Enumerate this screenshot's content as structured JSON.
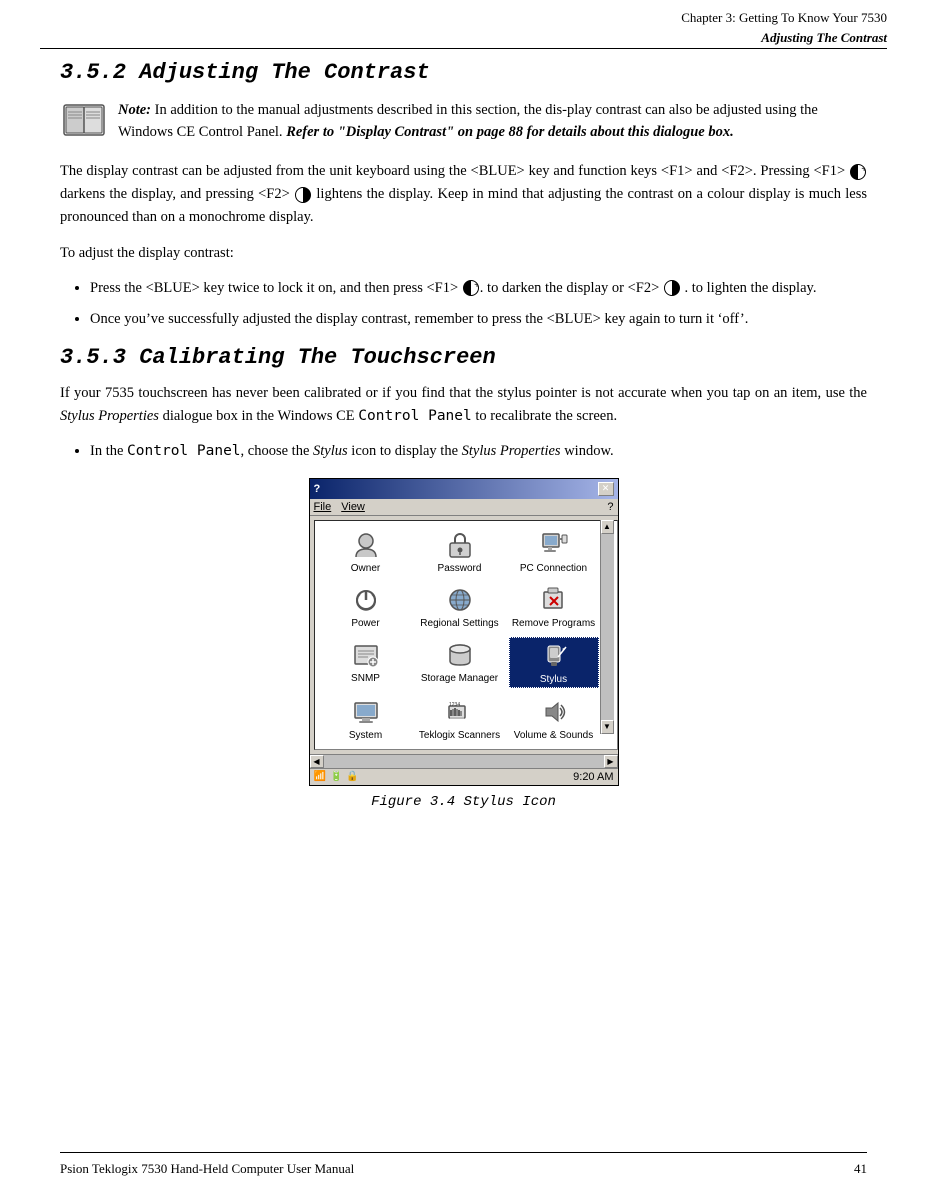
{
  "header": {
    "chapter_line": "Chapter  3:  Getting To Know Your 7530",
    "section_title": "Adjusting The Contrast"
  },
  "section_352": {
    "heading": "3.5.2   Adjusting The Contrast",
    "note_label": "Note:",
    "note_text": "In addition to the manual adjustments described in this section, the dis-play contrast can also be adjusted using the Windows CE Control Panel. ",
    "note_bold": "Refer to “Display Contrast” on page 88 for details about this dialogue box.",
    "para1": "The display contrast can be adjusted from the unit keyboard using the <BLUE> key and function keys <F1> and <F2>. Pressing <F1>",
    "para1b": "darkens the display, and pressing <F2>",
    "para1c": "lightens the display. Keep in mind that adjusting the contrast on a colour display is much less pronounced than on a monochrome display.",
    "para2": "To adjust the display contrast:",
    "bullet1a": "Press the <BLUE> key twice to lock it on, and then press <F1>",
    "bullet1b": ". to darken the display or <F2>",
    "bullet1c": ". to lighten the display.",
    "bullet2": "Once you’ve successfully adjusted the display contrast, remember to press the <BLUE> key again to turn it ‘off’."
  },
  "section_353": {
    "heading": "3.5.3   Calibrating The Touchscreen",
    "para1": "If your 7535 touchscreen has never been calibrated or if you find that the stylus pointer is not accurate when you tap on an item, use the",
    "para1_italic": "Stylus Properties",
    "para1b": "dialogue box in the Windows CE",
    "para1b_code": "Control Panel",
    "para1c": "to recalibrate the screen.",
    "bullet1a": "In the",
    "bullet1a_code": "Control Panel",
    "bullet1b": ", choose the",
    "bullet1b_italic": "Stylus",
    "bullet1c": "icon to display the",
    "bullet1c_italic": "Stylus Properties",
    "bullet1d": "window."
  },
  "figure": {
    "caption": "Figure 3.4  Stylus Icon"
  },
  "window": {
    "title": "?",
    "menu_items": [
      "File",
      "View"
    ],
    "close": "×",
    "icons": [
      {
        "label": "Owner",
        "icon": "👤"
      },
      {
        "label": "Password",
        "icon": "🔑"
      },
      {
        "label": "PC Connection",
        "icon": "🖥"
      },
      {
        "label": "Power",
        "icon": "🔌"
      },
      {
        "label": "Regional Settings",
        "icon": "🌐"
      },
      {
        "label": "Remove Programs",
        "icon": "📦"
      },
      {
        "label": "SNMP",
        "icon": "📋"
      },
      {
        "label": "Storage Manager",
        "icon": "💾"
      },
      {
        "label": "Stylus",
        "icon": "✏️"
      },
      {
        "label": "System",
        "icon": "⚙"
      },
      {
        "label": "Teklogix Scanners",
        "icon": "📊"
      },
      {
        "label": "Volume & Sounds",
        "icon": "🔊"
      }
    ],
    "status_time": "9:20 AM"
  },
  "footer": {
    "manual_title": "Psion Teklogix 7530 Hand-Held Computer User Manual",
    "page_number": "41"
  }
}
